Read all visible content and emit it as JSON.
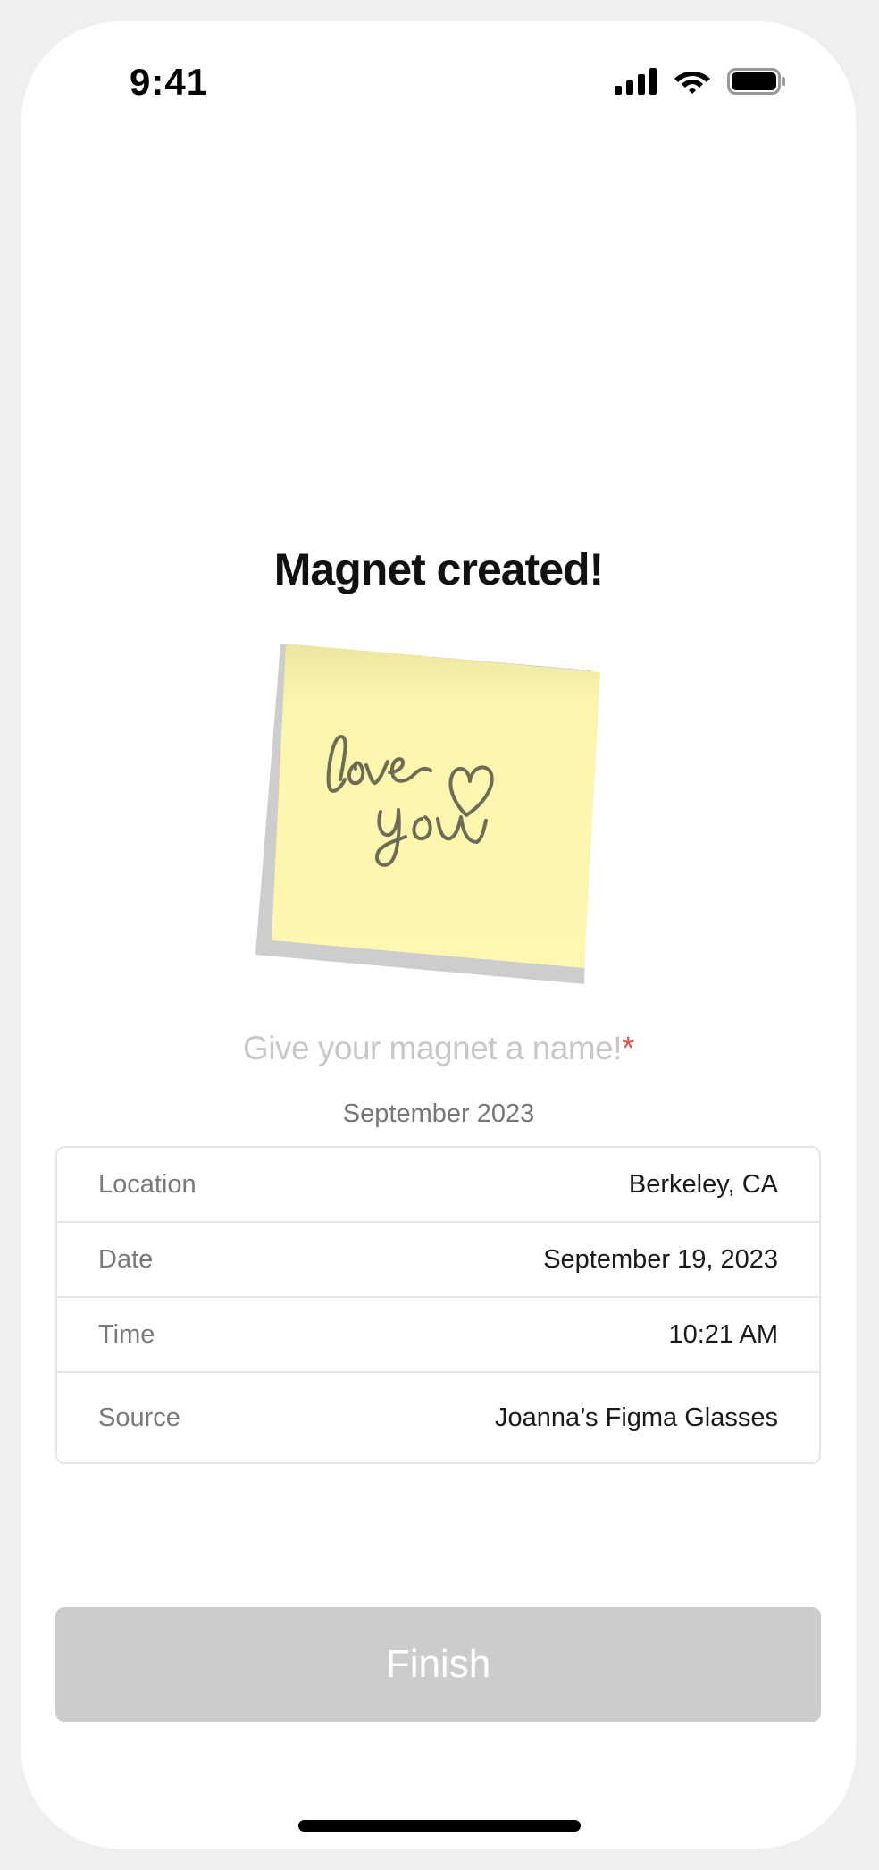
{
  "status_bar": {
    "time": "9:41",
    "icons": [
      "signal-icon",
      "wifi-icon",
      "battery-icon"
    ]
  },
  "title": "Magnet created!",
  "magnet": {
    "image": "sticky-note-image",
    "handwriting": "love you ♡"
  },
  "name_field": {
    "placeholder": "Give your magnet a name!",
    "required_marker": "*"
  },
  "subtitle": "September 2023",
  "details": [
    {
      "label": "Location",
      "value": "Berkeley, CA"
    },
    {
      "label": "Date",
      "value": "September 19, 2023"
    },
    {
      "label": "Time",
      "value": "10:21 AM"
    },
    {
      "label": "Source",
      "value": "Joanna’s Figma Glasses"
    }
  ],
  "finish_button": {
    "label": "Finish",
    "enabled": false
  },
  "colors": {
    "button_disabled": "#cccccc",
    "required": "#e05555",
    "sticky_note": "#fdf6ae"
  }
}
